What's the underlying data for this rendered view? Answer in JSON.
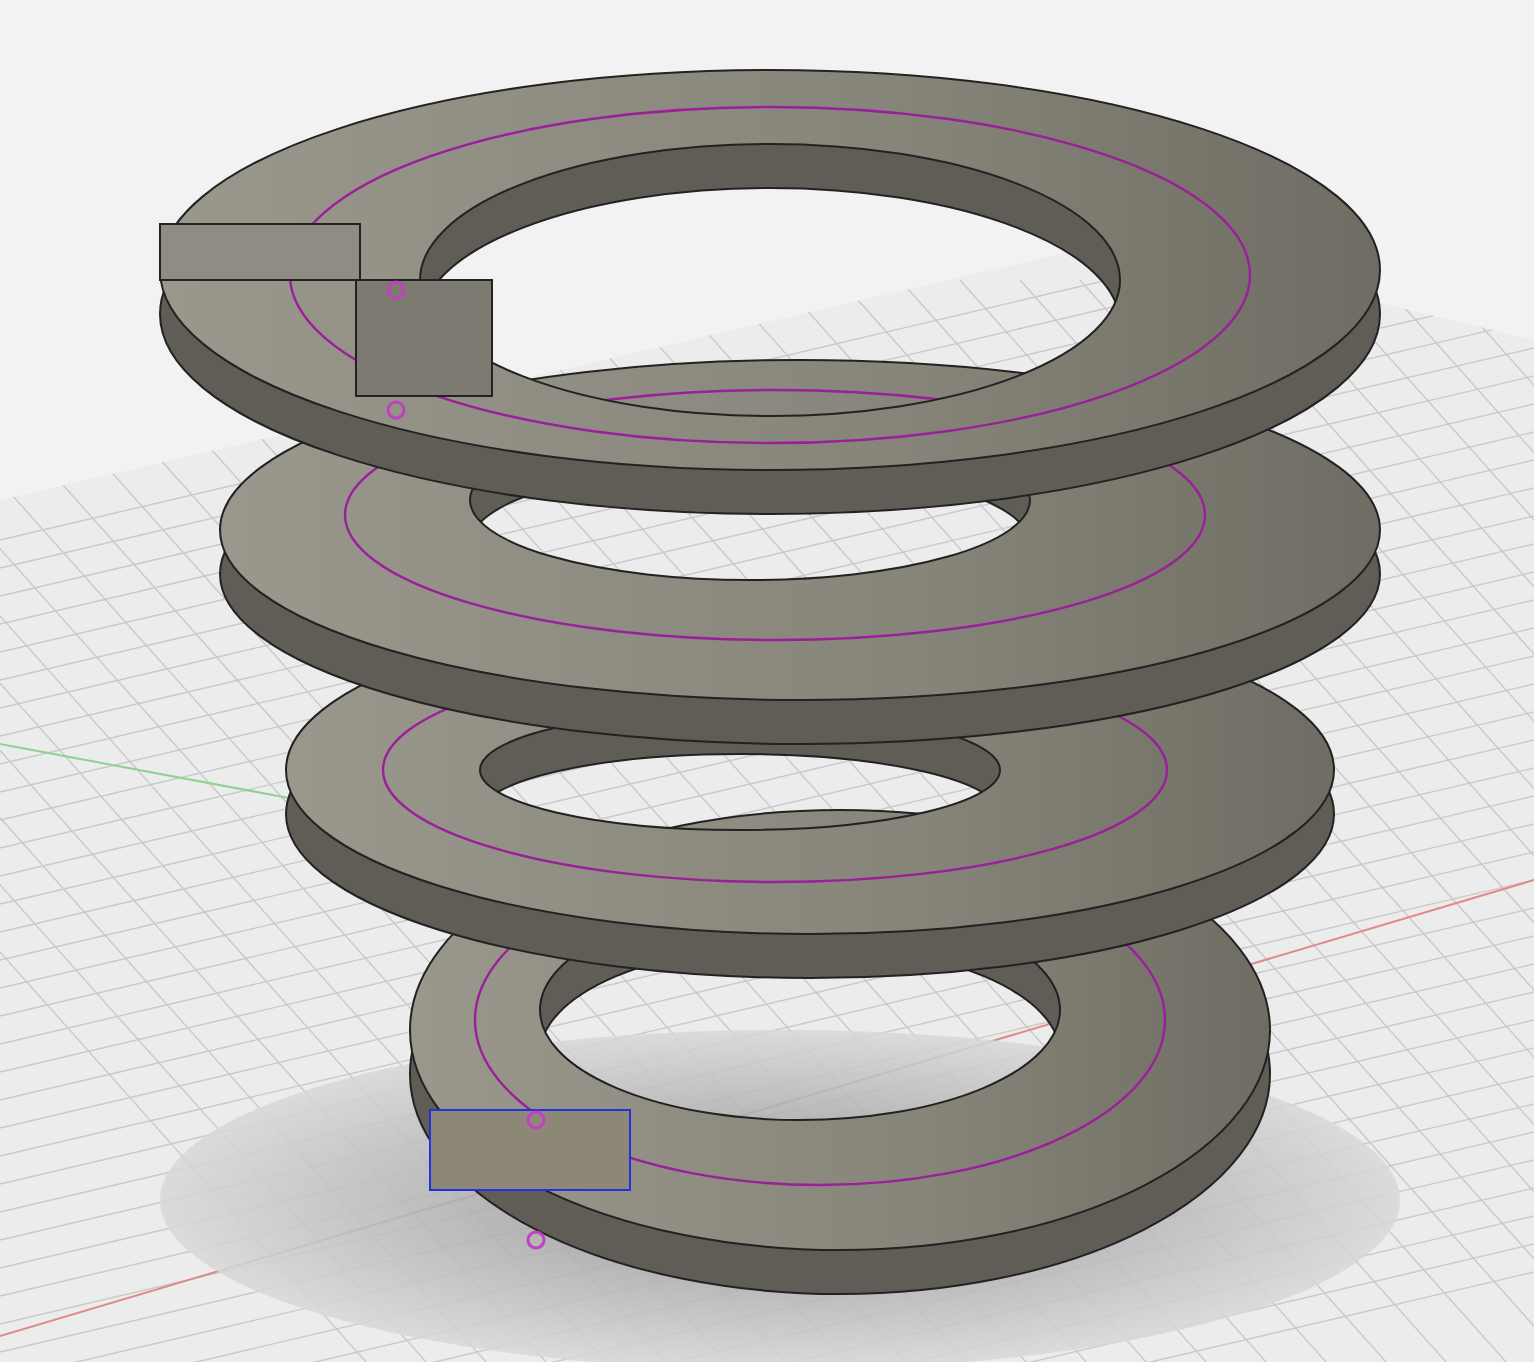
{
  "viewport": {
    "grid_visible": true,
    "origin_axes_visible": true,
    "sketch_points_visible": true
  }
}
